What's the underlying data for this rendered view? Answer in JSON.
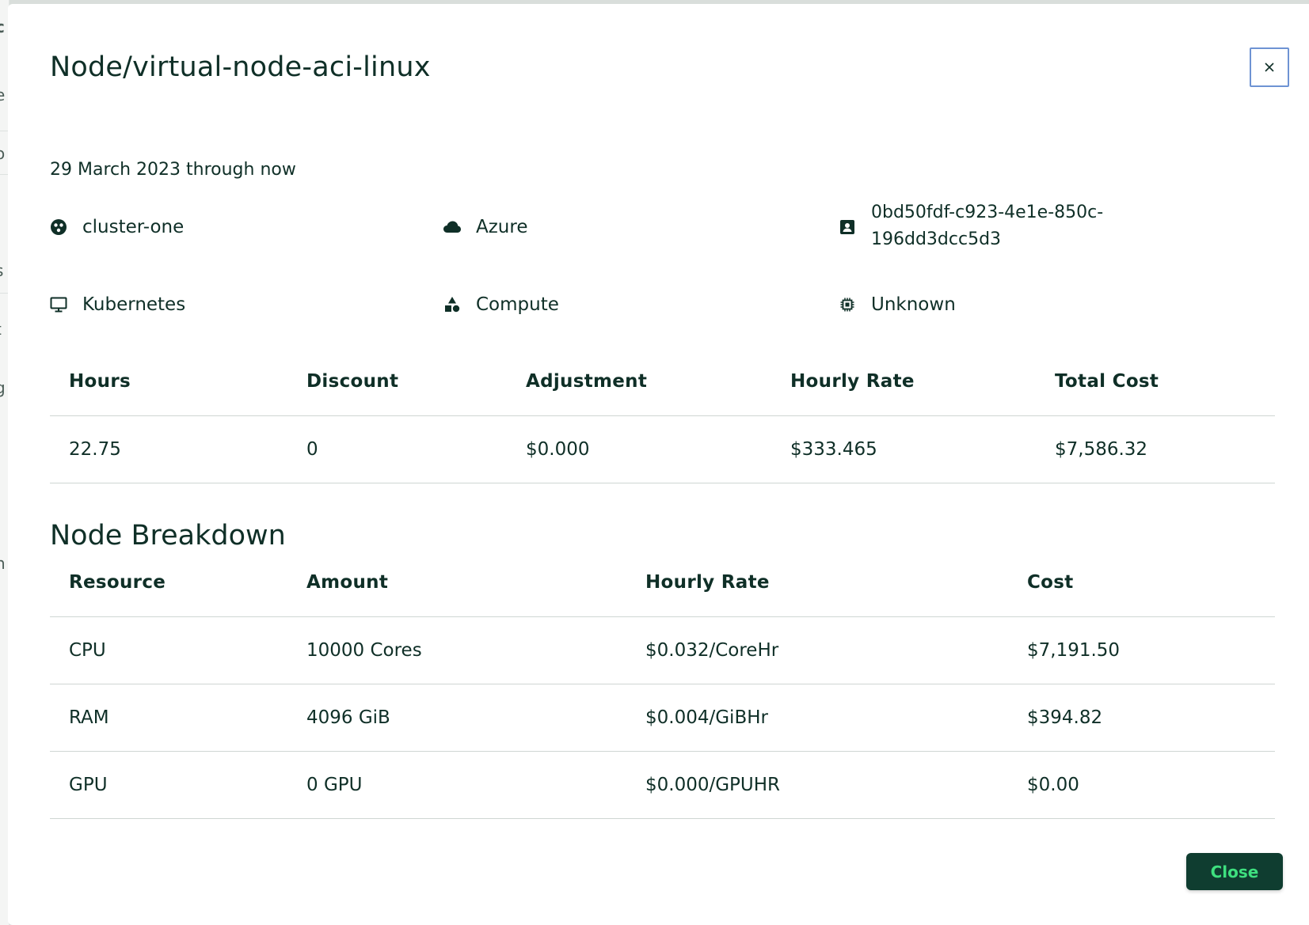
{
  "background": {
    "fragments": [
      "c",
      "e",
      "o",
      "l",
      "s",
      "t",
      "g",
      "h"
    ]
  },
  "modal": {
    "title": "Node/virtual-node-aci-linux",
    "close_icon": "close-icon",
    "date_range": "29 March 2023 through now",
    "meta": {
      "cluster": {
        "icon": "cluster-icon",
        "label": "cluster-one"
      },
      "provider": {
        "icon": "cloud-icon",
        "label": "Azure"
      },
      "account": {
        "icon": "account-box-icon",
        "label": "0bd50fdf-c923-4e1e-850c-196dd3dcc5d3"
      },
      "platform": {
        "icon": "monitor-icon",
        "label": "Kubernetes"
      },
      "category": {
        "icon": "category-shapes-icon",
        "label": "Compute"
      },
      "type": {
        "icon": "chip-icon",
        "label": "Unknown"
      }
    },
    "summary_table": {
      "headers": [
        "Hours",
        "Discount",
        "Adjustment",
        "Hourly Rate",
        "Total Cost"
      ],
      "rows": [
        [
          "22.75",
          "0",
          "$0.000",
          "$333.465",
          "$7,586.32"
        ]
      ]
    },
    "breakdown": {
      "title": "Node Breakdown",
      "headers": [
        "Resource",
        "Amount",
        "Hourly Rate",
        "Cost"
      ],
      "rows": [
        [
          "CPU",
          "10000 Cores",
          "$0.032/CoreHr",
          "$7,191.50"
        ],
        [
          "RAM",
          "4096 GiB",
          "$0.004/GiBHr",
          "$394.82"
        ],
        [
          "GPU",
          "0 GPU",
          "$0.000/GPUHR",
          "$0.00"
        ]
      ]
    },
    "close_button": "Close"
  },
  "colors": {
    "text": "#0f2f27",
    "close_button_bg": "#0f3d30",
    "close_button_text": "#3ee07f",
    "focus_ring": "#6e93d3"
  }
}
